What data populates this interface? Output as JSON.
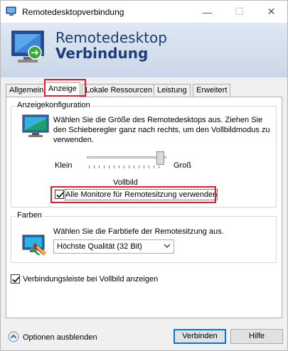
{
  "window": {
    "title": "Remotedesktopverbindung"
  },
  "titlebar": {
    "minimize": "—",
    "maximize": "☐",
    "close": "✕"
  },
  "header": {
    "line1": "Remotedesktop",
    "line2": "Verbindung"
  },
  "tabs": [
    {
      "label": "Allgemein",
      "active": false
    },
    {
      "label": "Anzeige",
      "active": true
    },
    {
      "label": "Lokale Ressourcen",
      "active": false
    },
    {
      "label": "Leistung",
      "active": false
    },
    {
      "label": "Erweitert",
      "active": false
    }
  ],
  "display_config": {
    "group_label": "Anzeigekonfiguration",
    "description": "Wählen Sie die Größe des Remotedesktops aus. Ziehen Sie den Schieberegler ganz nach rechts, um den Vollbildmodus zu verwenden.",
    "slider_min_label": "Klein",
    "slider_max_label": "Groß",
    "slider_value_label": "Vollbild",
    "slider_level": 1.0,
    "all_monitors_label": "Alle Monitore für Remotesitzung verwenden",
    "all_monitors_checked": true
  },
  "colors_group": {
    "group_label": "Farben",
    "description": "Wählen Sie die Farbtiefe der Remotesitzung aus.",
    "selected_depth": "Höchste Qualität (32 Bit)"
  },
  "connection_bar": {
    "label": "Verbindungsleiste bei Vollbild anzeigen",
    "checked": true
  },
  "footer": {
    "options_label": "Optionen ausblenden",
    "connect_label": "Verbinden",
    "help_label": "Hilfe"
  },
  "colors": {
    "highlight_red": "#e0202b",
    "header_title": "#1c3d7a",
    "accent_blue": "#0078d7"
  }
}
